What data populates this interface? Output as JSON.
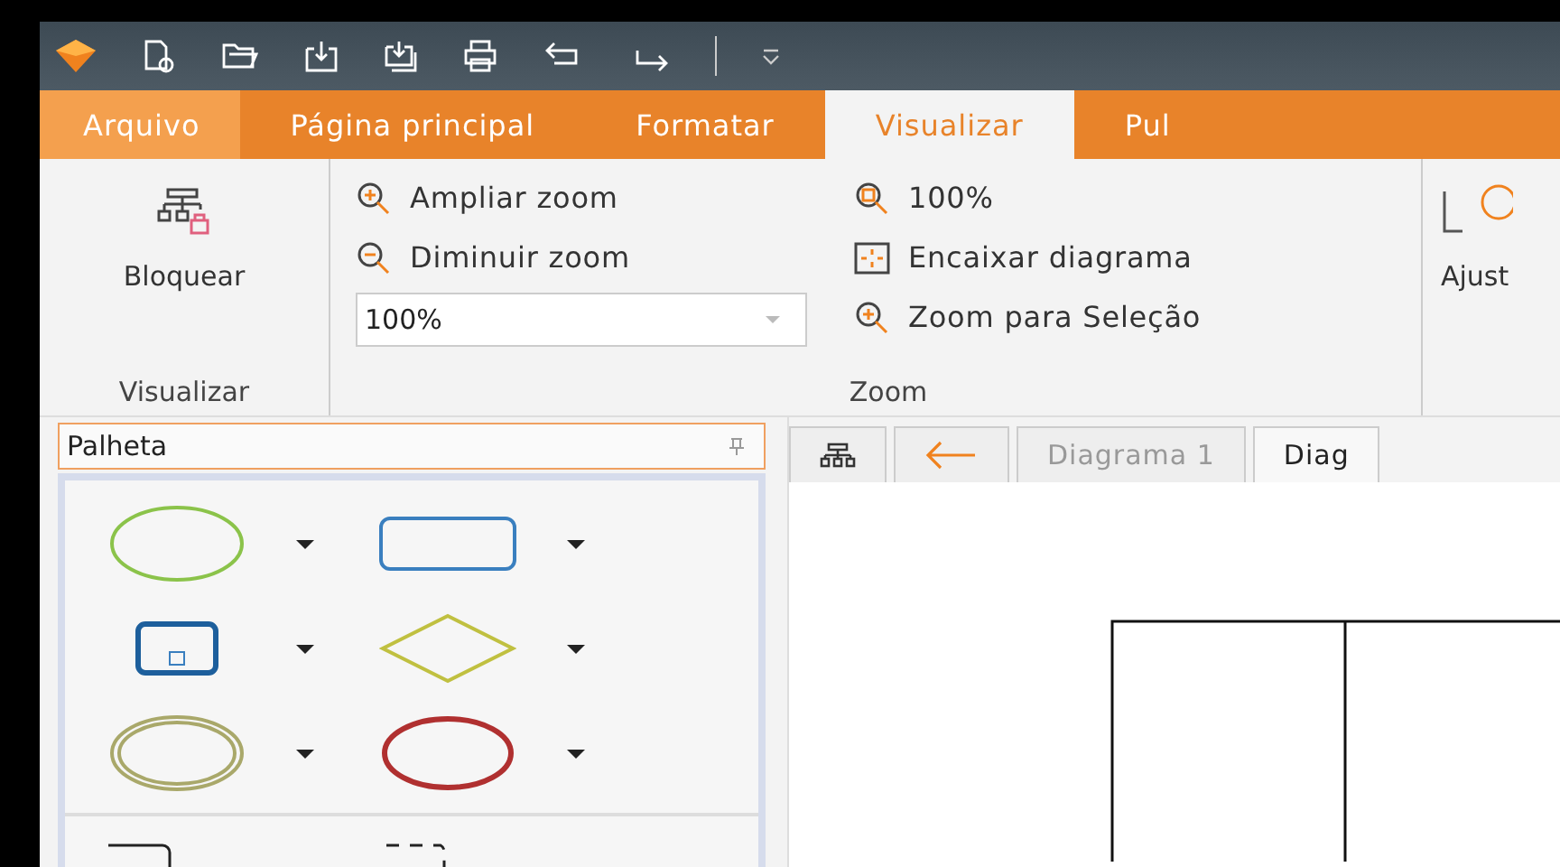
{
  "ribbon_tabs": [
    {
      "label": "Arquivo",
      "kind": "file",
      "selected": false
    },
    {
      "label": "Página principal",
      "kind": "tab",
      "selected": false
    },
    {
      "label": "Formatar",
      "kind": "tab",
      "selected": false
    },
    {
      "label": "Visualizar",
      "kind": "tab",
      "selected": true
    },
    {
      "label": "Pul",
      "kind": "tab",
      "selected": false
    }
  ],
  "ribbon": {
    "view_group": {
      "button": "Bloquear",
      "label": "Visualizar"
    },
    "zoom_group": {
      "zoom_in": "Ampliar zoom",
      "zoom_out": "Diminuir zoom",
      "zoom_value": "100%",
      "actual_size": "100%",
      "fit": "Encaixar diagrama",
      "zoom_selection": "Zoom para Seleção",
      "label": "Zoom"
    },
    "fit_button": "Ajust"
  },
  "palette": {
    "title": "Palheta"
  },
  "doc_tabs": [
    {
      "label": "Diagrama 1",
      "selected": false
    },
    {
      "label": "Diag",
      "selected": true
    }
  ]
}
